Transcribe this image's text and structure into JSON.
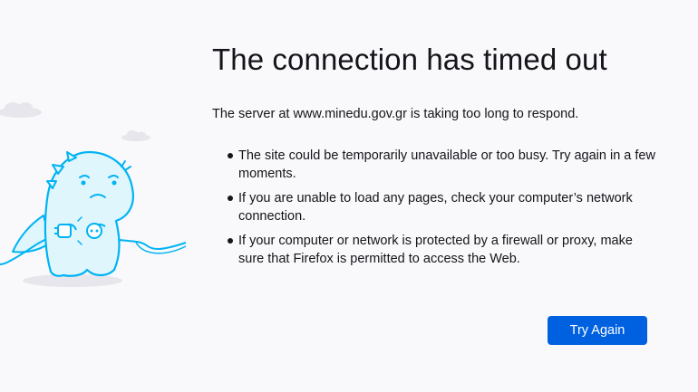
{
  "error": {
    "title": "The connection has timed out",
    "short_desc": "The server at www.minedu.gov.gr is taking too long to respond.",
    "advice": [
      "The site could be temporarily unavailable or too busy. Try again in a few moments.",
      "If you are unable to load any pages, check your computer’s network connection.",
      "If your computer or network is protected by a firewall or proxy, make sure that Firefox is permitted to access the Web."
    ],
    "try_again_label": "Try Again"
  },
  "illustration": {
    "icon": "dinosaur-unplugged-cable-icon",
    "stroke_color": "#00b3f4",
    "fill_color": "#e0f6fd",
    "cloud_color": "#e8e8ee"
  },
  "colors": {
    "background": "#f9f9fb",
    "text": "#15141a",
    "button": "#0061e0",
    "button_text": "#ffffff"
  }
}
